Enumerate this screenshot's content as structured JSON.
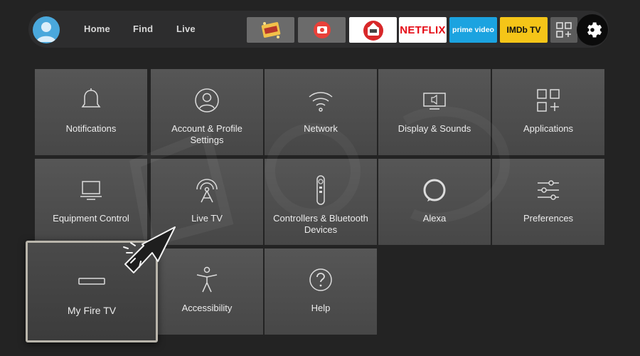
{
  "nav": {
    "tabs": [
      {
        "label": "Home"
      },
      {
        "label": "Find"
      },
      {
        "label": "Live"
      }
    ]
  },
  "apps": [
    {
      "name": "cinema-app",
      "bg": "#6b6b6b"
    },
    {
      "name": "red-media-app",
      "bg": "#6b6b6b"
    },
    {
      "name": "robot-app",
      "bg": "#ffffff"
    },
    {
      "name": "netflix",
      "label": "NETFLIX",
      "bg": "#ffffff",
      "color": "#e50914"
    },
    {
      "name": "prime-video",
      "label": "prime video",
      "bg": "#1ba3e0",
      "color": "#ffffff"
    },
    {
      "name": "imdb-tv",
      "label": "IMDb TV",
      "bg": "#f5c518",
      "color": "#111111"
    }
  ],
  "settings": {
    "tiles": [
      {
        "label": "Notifications",
        "icon": "bell-icon"
      },
      {
        "label": "Account & Profile Settings",
        "icon": "profile-icon"
      },
      {
        "label": "Network",
        "icon": "wifi-icon"
      },
      {
        "label": "Display & Sounds",
        "icon": "speaker-icon"
      },
      {
        "label": "Applications",
        "icon": "apps-grid-icon"
      },
      {
        "label": "Equipment Control",
        "icon": "tv-icon"
      },
      {
        "label": "Live TV",
        "icon": "antenna-icon"
      },
      {
        "label": "Controllers & Bluetooth Devices",
        "icon": "remote-icon"
      },
      {
        "label": "Alexa",
        "icon": "alexa-ring-icon"
      },
      {
        "label": "Preferences",
        "icon": "sliders-icon"
      },
      {
        "label": "My Fire TV",
        "icon": "fire-tv-device-icon"
      },
      {
        "label": "Accessibility",
        "icon": "accessibility-icon"
      },
      {
        "label": "Help",
        "icon": "help-icon"
      }
    ]
  },
  "colors": {
    "background": "#232323",
    "tile": "#505050",
    "focus_border": "#b9b5ab",
    "avatar": "#4aa8dc"
  }
}
